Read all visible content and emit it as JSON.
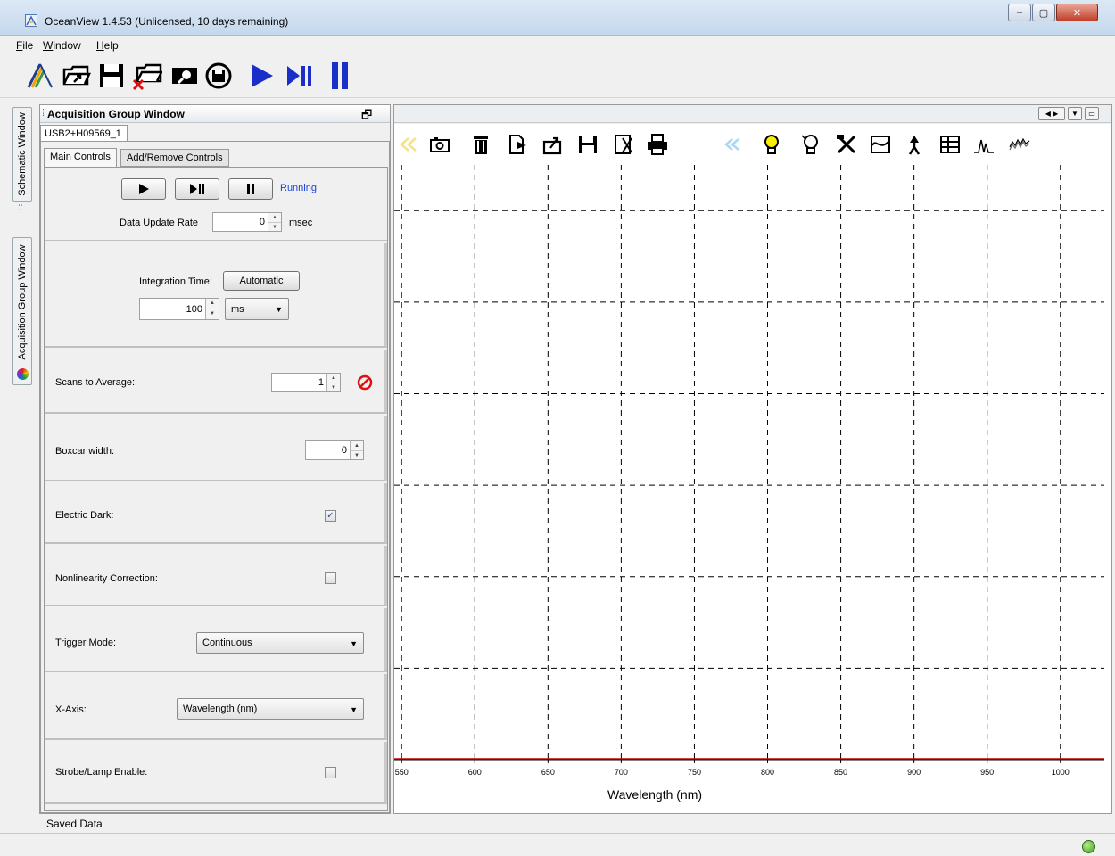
{
  "window": {
    "title": "OceanView 1.4.53 (Unlicensed, 10 days remaining)",
    "minimize": "–",
    "maximize": "▢",
    "close": "✕"
  },
  "menu": {
    "items": [
      {
        "mnemonic": "F",
        "rest": "ile"
      },
      {
        "mnemonic": "W",
        "rest": "indow"
      },
      {
        "mnemonic": "H",
        "rest": "elp"
      }
    ]
  },
  "toolbar": {
    "icons": [
      "new-project-icon",
      "open-icon",
      "save-icon",
      "close-project-icon",
      "search-device-icon",
      "device-reset-icon",
      "play-icon",
      "play-pause-icon",
      "pause-icon"
    ]
  },
  "dock": {
    "schematic_label": "Schematic Window",
    "acquisition_label": "Acquisition Group Window"
  },
  "acquisition": {
    "title": "Acquisition Group Window",
    "device_tab": "USB2+H09569_1",
    "tabs": {
      "main": "Main Controls",
      "add_remove": "Add/Remove Controls"
    },
    "status": "Running",
    "status_color": "#1a3fd6",
    "data_update_rate": {
      "label": "Data Update Rate",
      "value": "0",
      "unit": "msec"
    },
    "integration_time": {
      "label": "Integration Time:",
      "auto_button": "Automatic",
      "value": "100",
      "unit": "ms"
    },
    "scans_to_average": {
      "label": "Scans to Average:",
      "value": "1"
    },
    "boxcar_width": {
      "label": "Boxcar width:",
      "value": "0"
    },
    "electric_dark": {
      "label": "Electric Dark:",
      "checked": true
    },
    "nonlinearity": {
      "label": "Nonlinearity Correction:",
      "checked": false
    },
    "trigger_mode": {
      "label": "Trigger Mode:",
      "value": "Continuous"
    },
    "x_axis": {
      "label": "X-Axis:",
      "value": "Wavelength (nm)"
    },
    "strobe": {
      "label": "Strobe/Lamp Enable:",
      "checked": false
    }
  },
  "status_bar": {
    "saved_data": "Saved Data",
    "led_color": "#3c9a1e"
  },
  "chart_data": {
    "type": "line",
    "xlabel": "Wavelength (nm)",
    "ylabel": "",
    "xlim": [
      545,
      1030
    ],
    "ylim": [
      0,
      1
    ],
    "x_ticks": [
      550,
      600,
      650,
      700,
      750,
      800,
      850,
      900,
      950,
      1000
    ],
    "grid": true,
    "series": [
      {
        "color": "#c00000",
        "x": [
          545,
          1030
        ],
        "y": [
          0,
          0
        ]
      }
    ]
  }
}
